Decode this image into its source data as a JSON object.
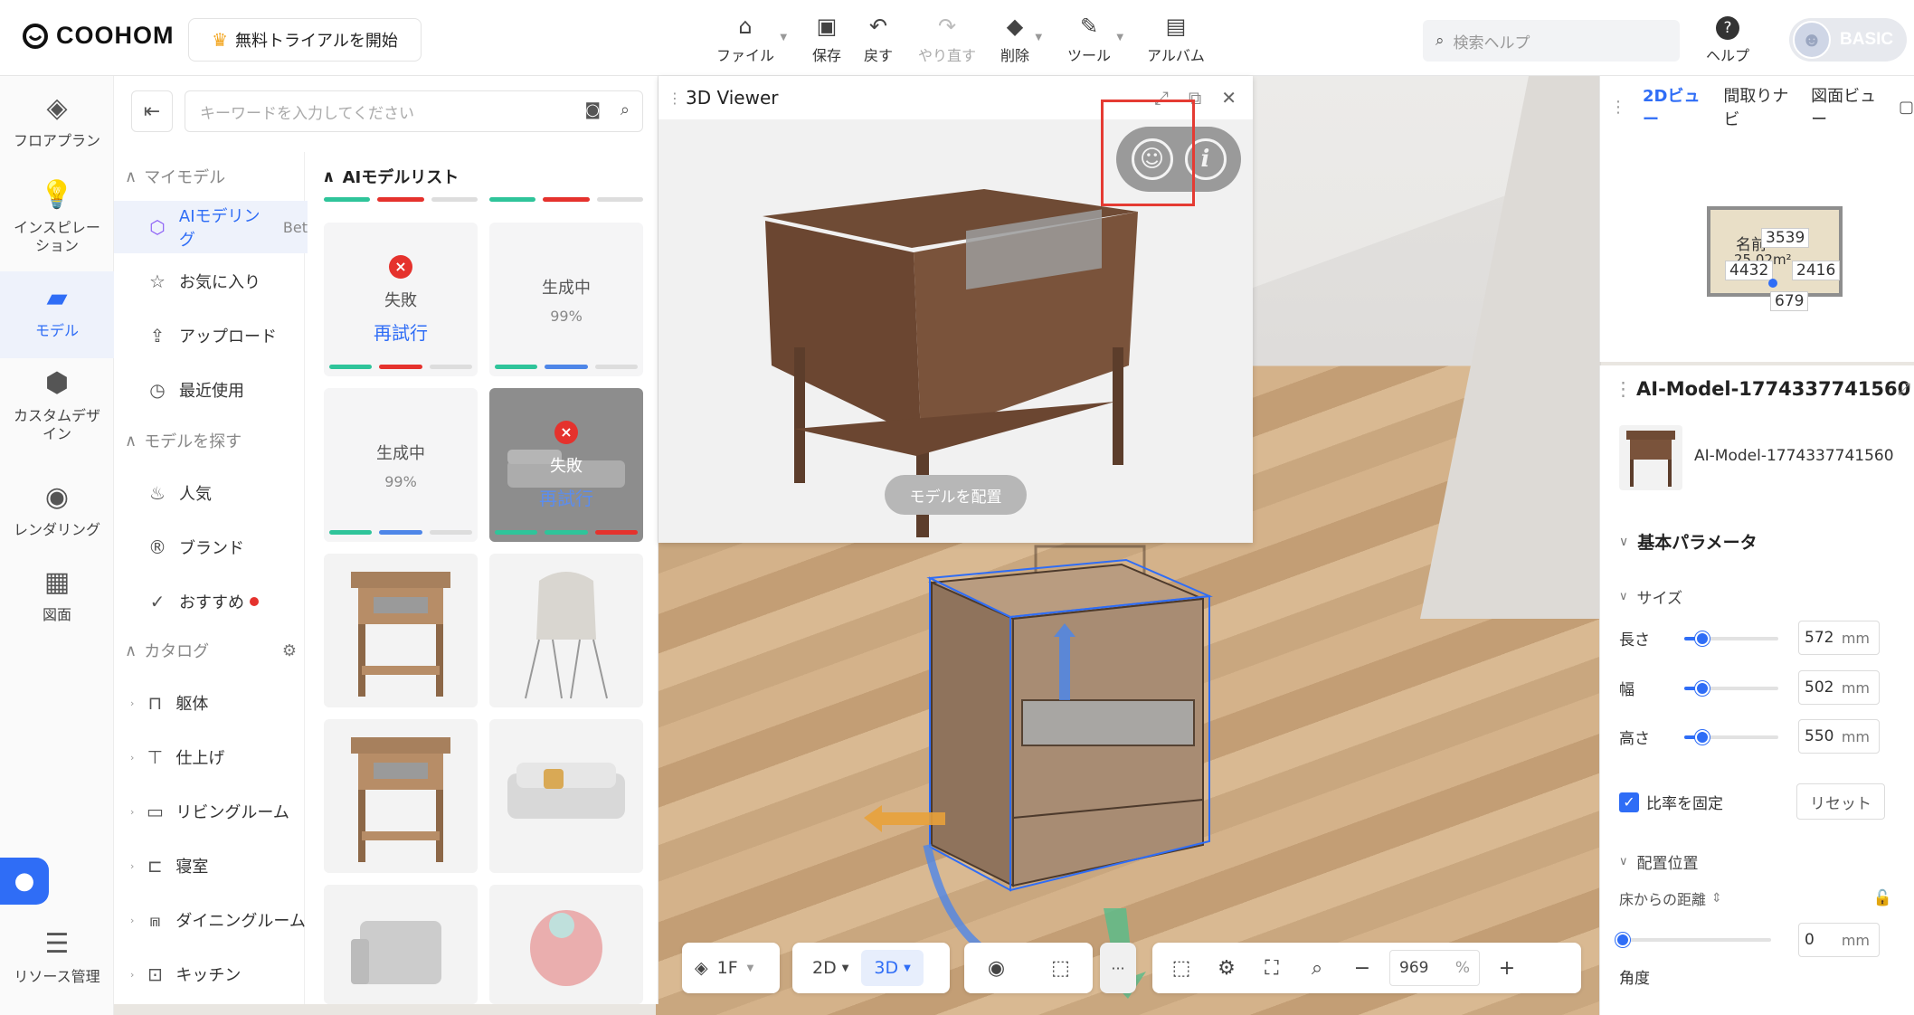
{
  "app": {
    "logo": "COOHOM",
    "trial": "無料トライアルを開始"
  },
  "toolbar": [
    {
      "label": "ファイル",
      "icon": "file-icon",
      "caret": true
    },
    {
      "label": "保存",
      "icon": "save-icon"
    },
    {
      "label": "戻す",
      "icon": "undo-icon"
    },
    {
      "label": "やり直す",
      "icon": "redo-icon"
    },
    {
      "label": "削除",
      "icon": "eraser-icon",
      "caret": true
    },
    {
      "label": "ツール",
      "icon": "wrench-icon",
      "caret": true
    },
    {
      "label": "アルバム",
      "icon": "album-icon"
    }
  ],
  "help": {
    "search_placeholder": "検索ヘルプ",
    "label": "ヘルプ",
    "badge": "BASIC"
  },
  "leftnav": [
    {
      "label": "フロアプラン",
      "icon": "floorplan-icon"
    },
    {
      "label": "インスピレーション",
      "icon": "bulb-icon"
    },
    {
      "label": "モデル",
      "icon": "sofa-icon",
      "active": true
    },
    {
      "label": "カスタムデザイン",
      "icon": "custom-design-icon"
    },
    {
      "label": "レンダリング",
      "icon": "camera-icon"
    },
    {
      "label": "図面",
      "icon": "drawing-icon"
    },
    {
      "label": "リソース管理",
      "icon": "resource-icon"
    }
  ],
  "panel": {
    "search_placeholder": "キーワードを入力してください",
    "my_models": "マイモデル",
    "ai_modeling": "AIモデリング",
    "ai_beta": "Bet",
    "favorites": "お気に入り",
    "upload": "アップロード",
    "recent": "最近使用",
    "find_models": "モデルを探す",
    "popular": "人気",
    "brand": "ブランド",
    "recommend": "おすすめ",
    "catalog": "カタログ",
    "categories": [
      "躯体",
      "仕上げ",
      "リビングルーム",
      "寝室",
      "ダイニングルーム",
      "キッチン"
    ],
    "list_title": "AIモデルリスト",
    "cards": [
      {
        "status": "失敗",
        "action": "再試行"
      },
      {
        "status": "生成中",
        "progress": "99%"
      },
      {
        "status": "生成中",
        "progress": "99%"
      },
      {
        "status": "失敗",
        "action": "再試行"
      }
    ]
  },
  "viewer": {
    "title": "3D Viewer",
    "place_button": "モデルを配置"
  },
  "minimap": {
    "tabs": [
      "2Dビュー",
      "間取りナビ",
      "図面ビュー"
    ],
    "room": "名前",
    "area": "25.02m²",
    "dims": [
      "3539",
      "4432",
      "2416",
      "679"
    ]
  },
  "props": {
    "title": "AI-Model-1774337741560",
    "name": "AI-Model-1774337741560",
    "basic": "基本パラメータ",
    "size": "サイズ",
    "length": "長さ",
    "length_val": "572",
    "width": "幅",
    "width_val": "502",
    "height": "高さ",
    "height_val": "550",
    "unit": "mm",
    "lock_ratio": "比率を固定",
    "reset": "リセット",
    "placement": "配置位置",
    "floor_dist": "床からの距離",
    "floor_val": "0",
    "angle": "角度"
  },
  "bottombar": {
    "floor": "1F",
    "mode2d": "2D",
    "mode3d": "3D",
    "zoom": "969",
    "pct": "%"
  }
}
